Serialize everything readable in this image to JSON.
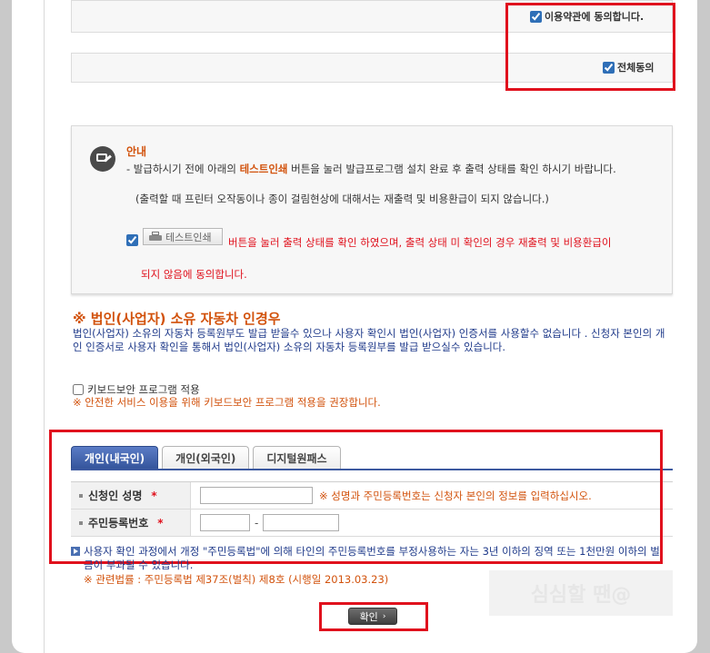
{
  "terms": {
    "terms_agree_label": "이용약관에 동의합니다.",
    "all_agree_label": "전체동의"
  },
  "notice": {
    "title": "안내",
    "line1_prefix": "- 발급하시기 전에 아래의 ",
    "line1_highlight": "테스트인쇄",
    "line1_suffix": " 버튼을 눌러 발급프로그램 설치 완료 후 출력 상태를 확인 하시기 바랍니다.",
    "line2": "(출력할 때 프린터 오작동이나 종이 걸림현상에 대해서는 재출력 및 비용환급이 되지 않습니다.)",
    "print_button_label": "테스트인쇄",
    "confirm_text": "버튼을 눌러 출력 상태를 확인 하였으며, 출력 상태 미 확인의 경우 재출력 및 비용환급이",
    "confirm_text2": "되지 않음에 동의합니다."
  },
  "corporate": {
    "title": "※ 법인(사업자) 소유 자동차 인경우",
    "text": "법인(사업자) 소유의 자동차 등록원부도 발급 받을수 있으나 사용자 확인시 법인(사업자) 인증서를 사용할수 없습니다 . 신청자 본인의 개인 인증서로 사용자 확인을 통해서 법인(사업자) 소유의 자동차 등록원부를 발급 받으실수 있습니다."
  },
  "keyboard": {
    "label": "키보드보안 프로그램 적용",
    "note": "※ 안전한 서비스 이용을 위해 키보드보안 프로그램 적용을 권장합니다."
  },
  "tabs": [
    {
      "label": "개인(내국인)"
    },
    {
      "label": "개인(외국인)"
    },
    {
      "label": "디지털원패스"
    }
  ],
  "form": {
    "name_label": "신청인 성명",
    "name_value": "",
    "name_note": "※ 성명과 주민등록번호는 신청자 본인의 정보를 입력하십시오.",
    "rrn_label": "주민등록번호",
    "rrn_dash": "-",
    "required_mark": "*"
  },
  "warning": {
    "text": "사용자 확인 과정에서 개정 \"주민등록법\"에 의해 타인의 주민등록번호를 부정사용하는 자는 3년 이하의 징역 또는 1천만원 이하의 벌금이 부과될 수 있습니다.",
    "law": "※ 관련법률 : 주민등록법 제37조(벌칙) 제8호 (시행일 2013.03.23)"
  },
  "watermark": "심심할 땐@",
  "confirm_button_label": "확인",
  "colors": {
    "highlight": "#e0111d",
    "orange": "#d2520c",
    "navy": "#1f3a8a",
    "tab_active": "#3d5aa0"
  }
}
